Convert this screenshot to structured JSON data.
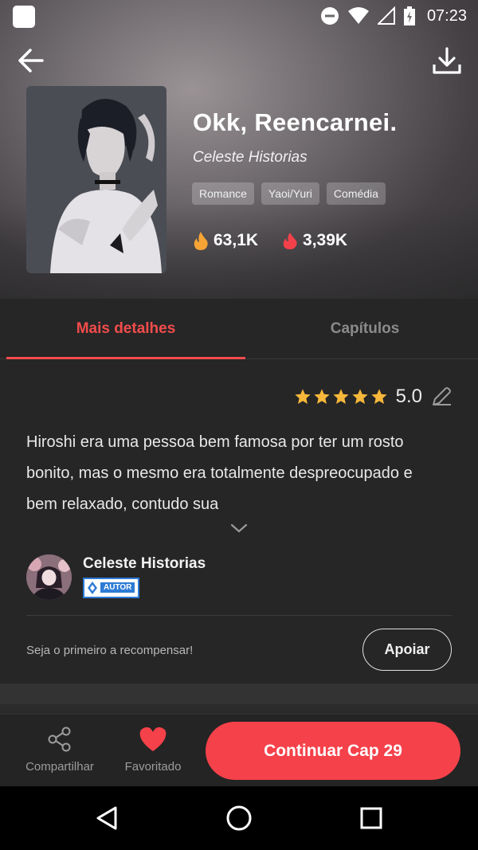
{
  "status_bar": {
    "time": "07:23"
  },
  "book": {
    "title": "Okk, Reencarnei.",
    "author": "Celeste Historias",
    "tags": [
      "Romance",
      "Yaoi/Yuri",
      "Comédia"
    ],
    "views": "63,1K",
    "likes": "3,39K"
  },
  "tabs": [
    {
      "label": "Mais detalhes",
      "active": true
    },
    {
      "label": "Capítulos",
      "active": false
    }
  ],
  "details": {
    "rating_value": "5.0",
    "stars": 5,
    "synopsis": "Hiroshi era uma pessoa bem famosa por ter um rosto bonito, mas o mesmo era totalmente despreocupado e bem relaxado, contudo sua",
    "author_name": "Celeste Historias",
    "author_badge": "AUTOR",
    "reward_text": "Seja o primeiro a recompensar!",
    "support_label": "Apoiar"
  },
  "bottom_bar": {
    "share_label": "Compartilhar",
    "favorite_label": "Favoritado",
    "continue_label": "Continuar Cap 29"
  },
  "colors": {
    "accent": "#f24c4c",
    "button": "#f5414a",
    "background": "#262626",
    "star": "#f7b73a"
  },
  "icons": {
    "back": "arrow-left-icon",
    "download": "download-icon",
    "views": "fire-icon",
    "likes": "red-fire-icon",
    "edit": "pencil-icon",
    "expand": "chevron-down-icon",
    "share": "share-icon",
    "favorite": "heart-icon"
  }
}
